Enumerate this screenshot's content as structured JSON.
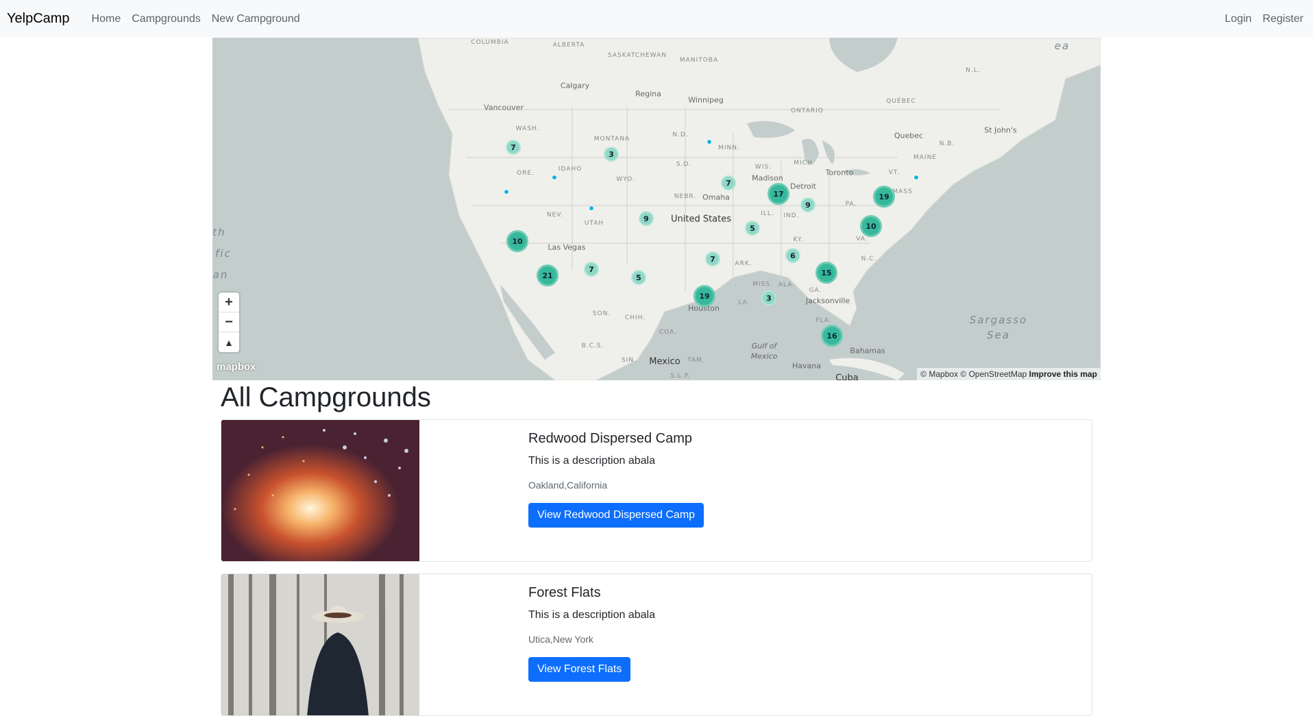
{
  "navbar": {
    "brand": "YelpCamp",
    "links": [
      "Home",
      "Campgrounds",
      "New Campground"
    ],
    "right": [
      "Login",
      "Register"
    ]
  },
  "map": {
    "labels": {
      "columbia": "COLUMBIA",
      "alberta": "ALBERTA",
      "saskatchewan": "SASKATCHEWAN",
      "manitoba": "MANITOBA",
      "ontario": "ONTARIO",
      "quebec_prov": "QUÉBEC",
      "nl": "N.L.",
      "calgary": "Calgary",
      "regina": "Regina",
      "winnipeg": "Winnipeg",
      "vancouver": "Vancouver",
      "quebec": "Quebec",
      "st_johns": "St John's",
      "wash": "WASH.",
      "montana": "MONTANA",
      "nd": "N.D.",
      "minn": "MINN.",
      "ore": "ORE.",
      "idaho": "IDAHO",
      "wyo": "WYO.",
      "sd": "S.D.",
      "madison": "Madison",
      "detroit": "Detroit",
      "toronto": "Toronto",
      "maine": "MAINE",
      "nb": "N.B.",
      "wis": "WIS.",
      "mich": "MICH",
      "nebr": "NEBR.",
      "omaha": "Omaha",
      "nev": "NEV.",
      "utah": "UTAH",
      "us": "United States",
      "ill": "ILL.",
      "ind": "IND.",
      "pa": "PA.",
      "mass": "MASS",
      "vt": "VT.",
      "las_vegas": "Las Vegas",
      "ky": "KY.",
      "va": "VA.",
      "nc": "N.C.",
      "ark": "ARK.",
      "miss": "MISS.",
      "ala": "ALA.",
      "ga": "GA.",
      "houston": "Houston",
      "la": "LA.",
      "jacksonville": "Jacksonville",
      "fla": "FLA.",
      "son": "SON.",
      "chih": "CHIH.",
      "coa": "COA.",
      "bcs": "B.C.S.",
      "sin": "SIN.",
      "tam": "TAM.",
      "slp": "S.L.P.",
      "mexico": "Mexico",
      "gulf1": "Gulf of",
      "gulf2": "Mexico",
      "havana": "Havana",
      "cuba": "Cuba",
      "bahamas": "Bahamas",
      "sargasso1": "Sargasso",
      "sargasso2": "Sea",
      "ocean1": "th",
      "ocean2": "fic",
      "ocean3": "an",
      "sea": "ea"
    },
    "clusters": [
      "7",
      "3",
      "7",
      "17",
      "9",
      "19",
      "9",
      "5",
      "10",
      "10",
      "21",
      "7",
      "5",
      "6",
      "7",
      "15",
      "19",
      "3",
      "16"
    ],
    "zoom_in": "+",
    "zoom_out": "−",
    "compass": "▲",
    "logo": "mapbox",
    "attribution": "© Mapbox © OpenStreetMap",
    "improve": "Improve this map",
    "colors": {
      "cluster_small": "#8fd8c6",
      "cluster_big": "#36b89b",
      "point": "#11b4da",
      "land": "#efefec",
      "water": "#c3cdcc"
    }
  },
  "page_title": "All Campgrounds",
  "campgrounds": [
    {
      "title": "Redwood Dispersed Camp",
      "description": "This is a description abala",
      "location": "Oakland,California",
      "button": "View Redwood Dispersed Camp"
    },
    {
      "title": "Forest Flats",
      "description": "This is a description abala",
      "location": "Utica,New York",
      "button": "View Forest Flats"
    }
  ]
}
